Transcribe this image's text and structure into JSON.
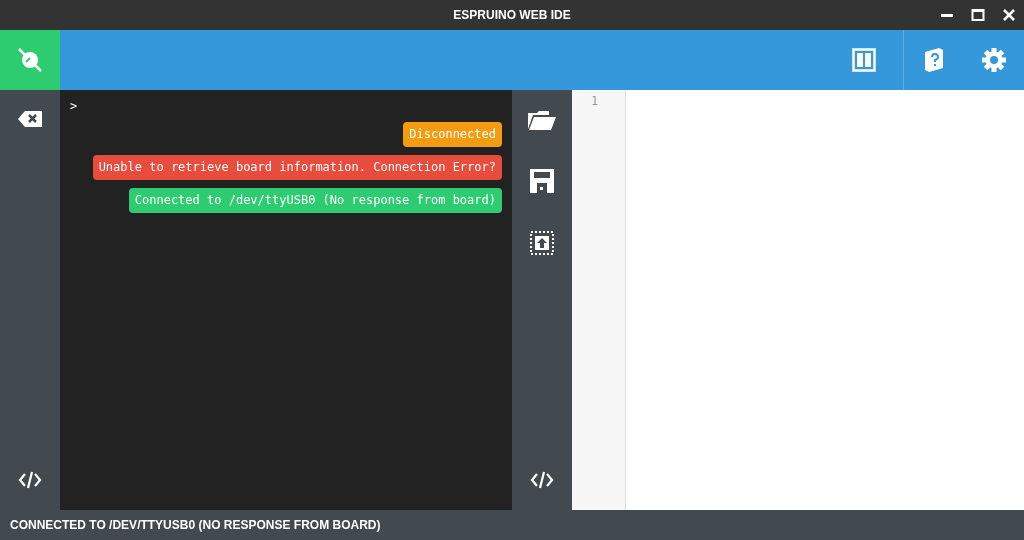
{
  "window": {
    "title": "ESPRUINO WEB IDE"
  },
  "terminal": {
    "prompt": ">",
    "messages": [
      {
        "text": "Disconnected",
        "color": "#f39c12"
      },
      {
        "text": "Unable to retrieve board information. Connection Error?",
        "color": "#e74c3c"
      },
      {
        "text": "Connected to /dev/ttyUSB0 (No response from board)",
        "color": "#2ecc71"
      }
    ]
  },
  "editor": {
    "line_numbers": [
      "1"
    ]
  },
  "status_bar": {
    "text": "CONNECTED TO /DEV/TTYUSB0 (NO RESPONSE FROM BOARD)"
  }
}
